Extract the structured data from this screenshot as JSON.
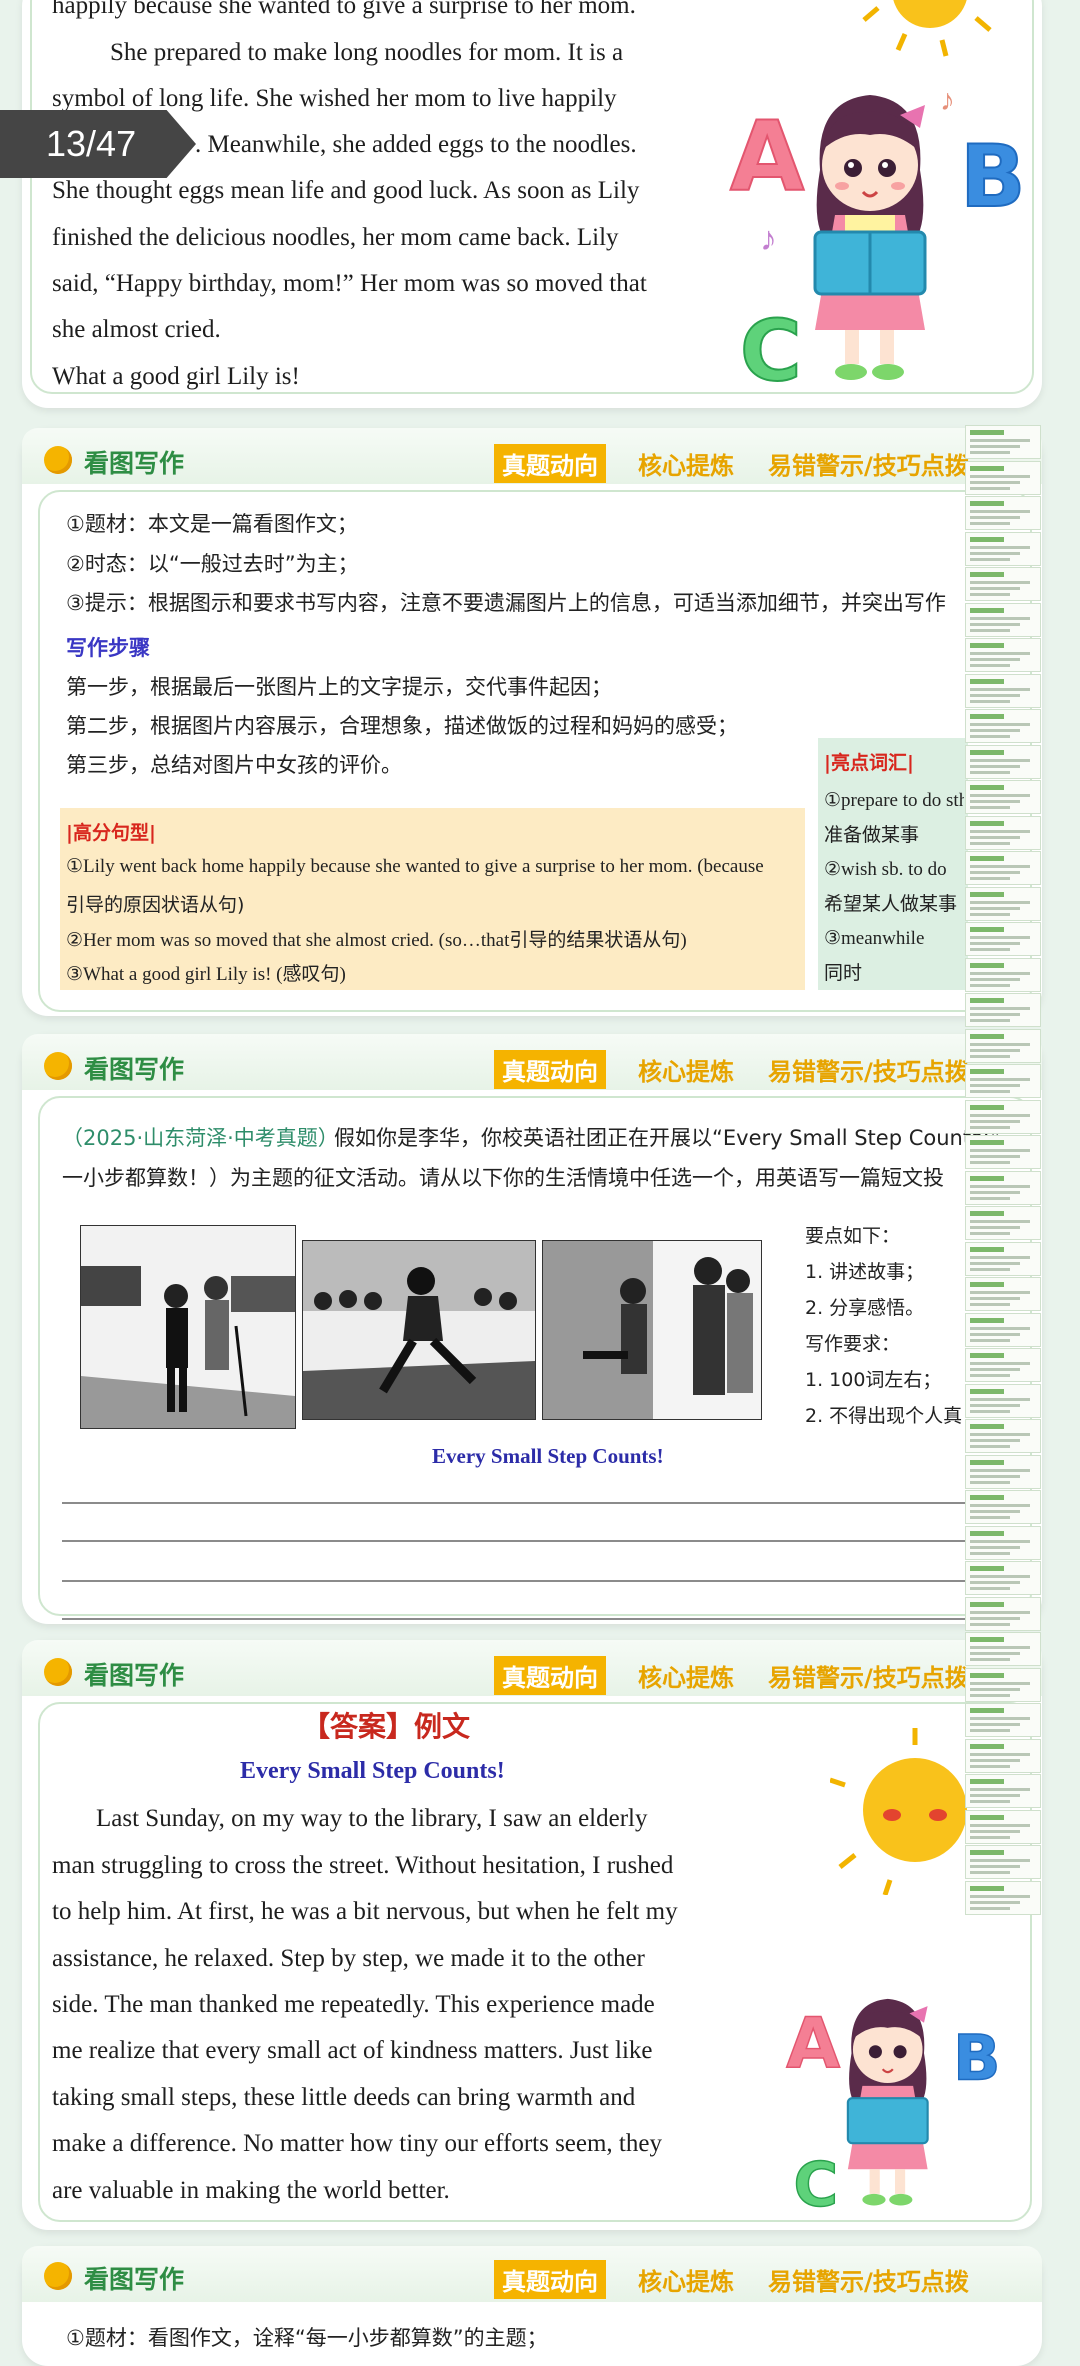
{
  "page_badge": "13/47",
  "section1": {
    "lines": [
      "happily because she wanted to give a surprise to her mom.",
      "She prepared to make long noodles for mom. It is a",
      "symbol of long life. She wished her mom to live happily",
      ". Meanwhile, she added eggs to the noodles.",
      "She thought eggs mean life and good luck. As soon as Lily",
      "finished the delicious noodles, her mom came back. Lily",
      "said, “Happy birthday, mom!” Her mom was so moved that",
      "she almost cried.",
      "What a good girl Lily is!"
    ]
  },
  "header": {
    "title": "看图写作",
    "tabs": [
      "真题动向",
      "核心提炼",
      "易错警示/技巧点拨"
    ]
  },
  "section2": {
    "points": [
      "①题材：本文是一篇看图作文；",
      "②时态：以“一般过去时”为主；",
      "③提示：根据图示和要求书写内容，注意不要遗漏图片上的信息，可适当添加细节，并突出写作"
    ],
    "steps_title": "写作步骤",
    "steps": [
      "第一步，根据最后一张图片上的文字提示，交代事件起因；",
      "第二步，根据图片内容展示，合理想象，描述做饭的过程和妈妈的感受；",
      "第三步，总结对图片中女孩的评价。"
    ],
    "sentences_title": "|高分句型|",
    "sentences": [
      "①Lily went back home happily because she wanted to give a surprise to her mom. (because",
      "引导的原因状语从句)",
      "②Her mom was so moved that she almost cried. (so…that引导的结果状语从句)",
      "③What a good girl Lily is! (感叹句)"
    ],
    "vocab_title": "|亮点词汇|",
    "vocab": [
      "①prepare to do sth.",
      "准备做某事",
      "②wish sb. to do",
      "希望某人做某事",
      "③meanwhile",
      "同时"
    ]
  },
  "section3": {
    "source": "（2025·山东菏泽·中考真题）",
    "prompt1": "假如你是李华，你校英语社团正在开展以“Every Small Step Counts!”",
    "prompt2": "一小步都算数！）为主题的征文活动。请从以下你的生活情境中任选一个，用英语写一篇短文投",
    "requirements": [
      "要点如下：",
      "1. 讲述故事；",
      "2. 分享感悟。",
      "写作要求：",
      "1. 100词左右；",
      "2. 不得出现个人真"
    ],
    "caption": "Every Small Step Counts!"
  },
  "section4": {
    "answer_label": "【答案】例文",
    "essay_title": "Every Small Step Counts!",
    "lines": [
      "Last Sunday, on my way to the library, I saw an elderly",
      "man struggling to cross the street. Without hesitation, I rushed",
      "to help him. At first, he was a bit nervous, but when he felt my",
      "assistance, he relaxed. Step by step, we made it to the other",
      "side. The man thanked me repeatedly. This experience made",
      "me realize that every small act of kindness matters. Just like",
      "taking small steps, these little deeds can bring warmth and",
      "make a difference. No matter how tiny our efforts seem, they",
      "are valuable in making the world better."
    ]
  },
  "section5": {
    "first_line": "①题材：看图作文，诠释“每一小步都算数”的主题；"
  },
  "colors": {
    "green": "#2e8d44",
    "orange": "#f5b300",
    "red": "#c8281e",
    "blue": "#2c2ca8"
  }
}
